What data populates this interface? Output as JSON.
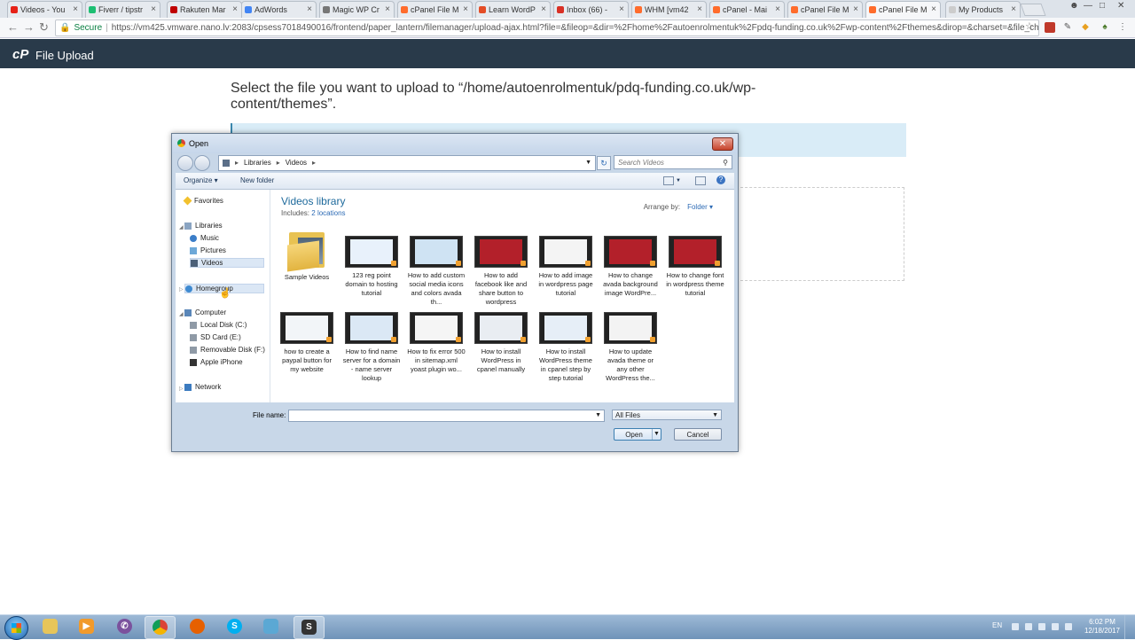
{
  "browser": {
    "tabs": [
      {
        "label": "Videos - You",
        "color": "#e62117",
        "active": false
      },
      {
        "label": "Fiverr / tipstr",
        "color": "#1dbf73",
        "active": false
      },
      {
        "label": "Rakuten Mar",
        "color": "#bf0000",
        "active": false
      },
      {
        "label": "AdWords",
        "color": "#4285f4",
        "active": false
      },
      {
        "label": "Magic WP Cr",
        "color": "#777777",
        "active": false
      },
      {
        "label": "cPanel File M",
        "color": "#ff6c2c",
        "active": false
      },
      {
        "label": "Learn WordP",
        "color": "#e44d26",
        "active": false
      },
      {
        "label": "Inbox (66) -",
        "color": "#d93025",
        "active": false
      },
      {
        "label": "WHM [vm42",
        "color": "#ff6c2c",
        "active": false
      },
      {
        "label": "cPanel - Mai",
        "color": "#ff6c2c",
        "active": false
      },
      {
        "label": "cPanel File M",
        "color": "#ff6c2c",
        "active": false
      },
      {
        "label": "cPanel File M",
        "color": "#ff6c2c",
        "active": true
      },
      {
        "label": "My Products",
        "color": "#cccccc",
        "active": false
      }
    ],
    "address": {
      "secure_label": "Secure",
      "url": "https://vm425.vmware.nano.lv:2083/cpsess7018490016/frontend/paper_lantern/filemanager/upload-ajax.html?file=&fileop=&dir=%2Fhome%2Fautoenrolmentuk%2Fpdq-funding.co.uk%2Fwp-content%2Fthemes&dirop=&charset=&file_charset=&b..."
    }
  },
  "page": {
    "header_title": "File Upload",
    "instruction": "Select the file you want to upload to “/home/autoenrolmentuk/pdq-funding.co.uk/wp-content/themes”."
  },
  "dialog": {
    "title": "Open",
    "path": [
      "Libraries",
      "Videos"
    ],
    "search_placeholder": "Search Videos",
    "organize_label": "Organize ▾",
    "new_folder_label": "New folder",
    "nav": {
      "favorites": "Favorites",
      "libraries": "Libraries",
      "music": "Music",
      "pictures": "Pictures",
      "videos": "Videos",
      "homegroup": "Homegroup",
      "computer": "Computer",
      "local_disk": "Local Disk (C:)",
      "sd_card": "SD Card (E:)",
      "removable": "Removable Disk (F:)",
      "iphone": "Apple iPhone",
      "network": "Network"
    },
    "library_title": "Videos library",
    "includes_label": "Includes:",
    "includes_link": "2 locations",
    "arrange_label": "Arrange by:",
    "arrange_value": "Folder ▾",
    "files": [
      {
        "name": "Sample Videos",
        "kind": "folder"
      },
      {
        "name": "123 reg point domain to hosting tutorial",
        "kind": "video",
        "tint": "#e8f1fb"
      },
      {
        "name": "How to add custom social media icons and colors avada th...",
        "kind": "video",
        "tint": "#cfe3f3"
      },
      {
        "name": "How to add facebook like and share button to wordpress",
        "kind": "video",
        "tint": "#b3202a"
      },
      {
        "name": "How to add image in wordpress page tutorial",
        "kind": "video",
        "tint": "#f4f4f4"
      },
      {
        "name": "How to change avada background image WordPre...",
        "kind": "video",
        "tint": "#b3202a"
      },
      {
        "name": "How to change font in wordpress theme tutorial",
        "kind": "video",
        "tint": "#b3202a"
      },
      {
        "name": "how to create a paypal button for my website",
        "kind": "video",
        "tint": "#f2f5f8"
      },
      {
        "name": "How to find name server for a domain - name server lookup",
        "kind": "video",
        "tint": "#dbe8f5"
      },
      {
        "name": "How to fix error 500 in sitemap.xml yoast plugin wo...",
        "kind": "video",
        "tint": "#f5f5f5"
      },
      {
        "name": "How to install WordPress in cpanel manually",
        "kind": "video",
        "tint": "#e9edf2"
      },
      {
        "name": "How to install WordPress theme in cpanel step by step tutorial",
        "kind": "video",
        "tint": "#e6eef7"
      },
      {
        "name": "How to update avada theme or any other WordPress the...",
        "kind": "video",
        "tint": "#f3f3f3"
      }
    ],
    "file_name_label": "File name:",
    "file_name_value": "",
    "file_type": "All Files",
    "open_label": "Open",
    "cancel_label": "Cancel"
  },
  "taskbar": {
    "lang": "EN",
    "time": "6:02 PM",
    "date": "12/18/2017"
  }
}
